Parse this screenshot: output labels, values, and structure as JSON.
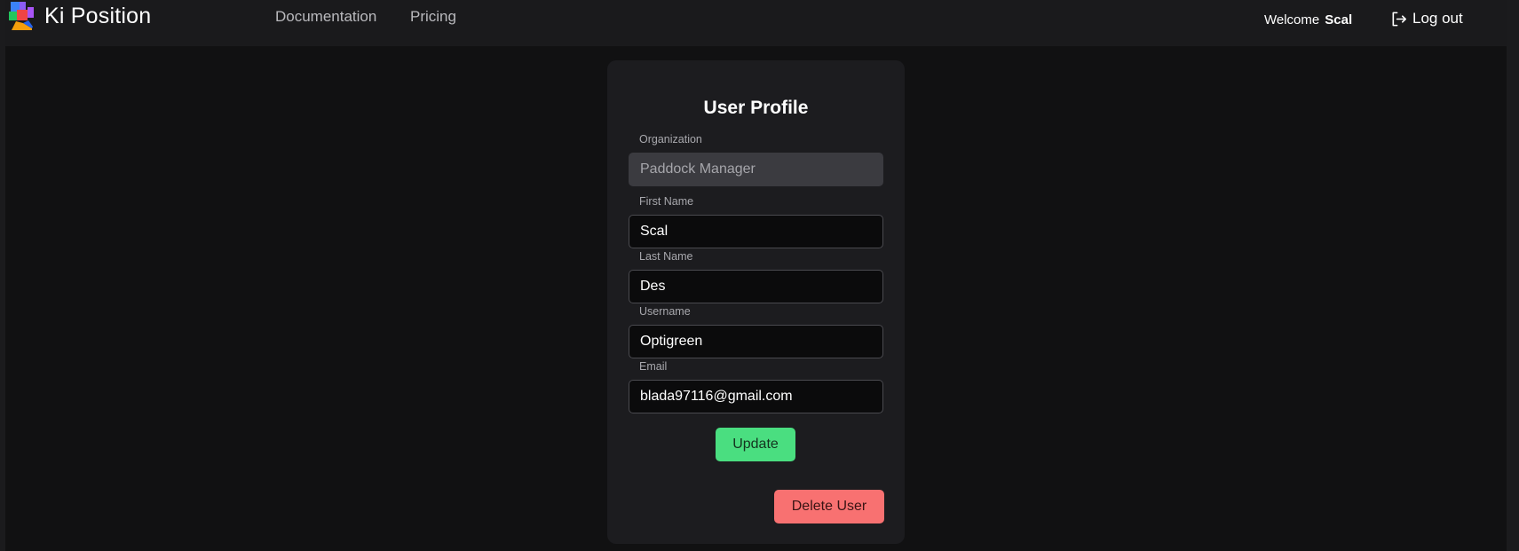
{
  "app": {
    "title": "Ki Position",
    "logo_icon": "ki-position-logo-icon"
  },
  "nav": {
    "links": [
      {
        "label": "Documentation"
      },
      {
        "label": "Pricing"
      }
    ]
  },
  "header": {
    "welcome_label": "Welcome",
    "username": "Scal",
    "logout_label": "Log out",
    "logout_icon": "logout-icon"
  },
  "profile": {
    "title": "User Profile",
    "fields": {
      "organization": {
        "label": "Organization",
        "value": "Paddock Manager",
        "disabled": true
      },
      "first_name": {
        "label": "First Name",
        "value": "Scal"
      },
      "last_name": {
        "label": "Last Name",
        "value": "Des"
      },
      "username": {
        "label": "Username",
        "value": "Optigreen"
      },
      "email": {
        "label": "Email",
        "value": "blada97116@gmail.com"
      }
    },
    "update_label": "Update",
    "delete_label": "Delete User"
  },
  "colors": {
    "background": "#111112",
    "navbar": "#1a1a1c",
    "card": "#1c1c1f",
    "update_button": "#4ade80",
    "delete_button": "#f87171"
  }
}
